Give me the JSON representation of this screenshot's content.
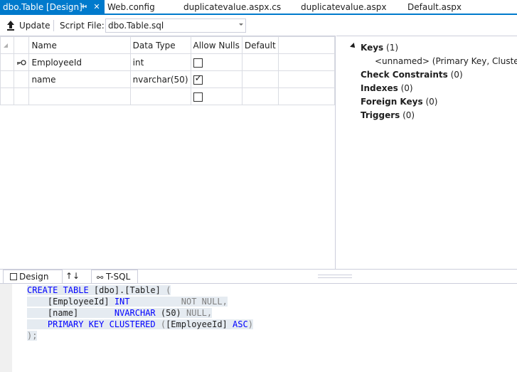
{
  "tabs": [
    {
      "label": "dbo.Table [Design]",
      "active": true
    },
    {
      "label": "Web.config"
    },
    {
      "label": "duplicatevalue.aspx.cs"
    },
    {
      "label": "duplicatevalue.aspx"
    },
    {
      "label": "Default.aspx"
    }
  ],
  "toolbar": {
    "update_label": "Update",
    "script_file_label": "Script File:",
    "script_file_value": "dbo.Table.sql"
  },
  "grid": {
    "headers": [
      "Name",
      "Data Type",
      "Allow Nulls",
      "Default"
    ],
    "rows": [
      {
        "name": "EmployeeId",
        "type": "int",
        "allow_nulls": false,
        "default": "",
        "is_key": true
      },
      {
        "name": "name",
        "type": "nvarchar(50)",
        "allow_nulls": true,
        "default": "",
        "is_key": false
      },
      {
        "name": "",
        "type": "",
        "allow_nulls": false,
        "default": "",
        "is_key": false
      }
    ]
  },
  "properties": {
    "keys_label": "Keys",
    "keys_count": "(1)",
    "key_item": "<unnamed>  (Primary Key, Clustered: EmployeeId)",
    "check_label": "Check Constraints",
    "check_count": "(0)",
    "indexes_label": "Indexes",
    "indexes_count": "(0)",
    "fk_label": "Foreign Keys",
    "fk_count": "(0)",
    "triggers_label": "Triggers",
    "triggers_count": "(0)"
  },
  "bottom_tabs": {
    "design_label": "Design",
    "swap_label": "↑↓",
    "tsql_label": "T-SQL"
  },
  "sql": {
    "l1_kw": "CREATE TABLE",
    "l1_obj": " [dbo].[Table] ",
    "l1_paren": "(",
    "l2_col": "[EmployeeId] ",
    "l2_type": "INT",
    "l2_null": "NOT NULL,",
    "l3_col": "[name]",
    "l3_type": "NVARCHAR",
    "l3_size": " (50) ",
    "l3_null": "NULL,",
    "l4_kw": "PRIMARY KEY CLUSTERED",
    "l4_paren_open": " (",
    "l4_col": "[EmployeeId]",
    "l4_asc": " ASC",
    "l4_paren_close": ")",
    "l5": ");"
  },
  "colors": {
    "accent": "#007acc",
    "keyword": "#0000ff",
    "gray_text": "#808080",
    "selection": "#e5ebf1"
  },
  "icons": {
    "pin": "pin-icon",
    "close": "close-icon",
    "update": "update-arrow-icon",
    "key": "primary-key-icon",
    "design": "design-icon",
    "swap": "swap-panes-icon",
    "tsql": "tsql-icon"
  }
}
